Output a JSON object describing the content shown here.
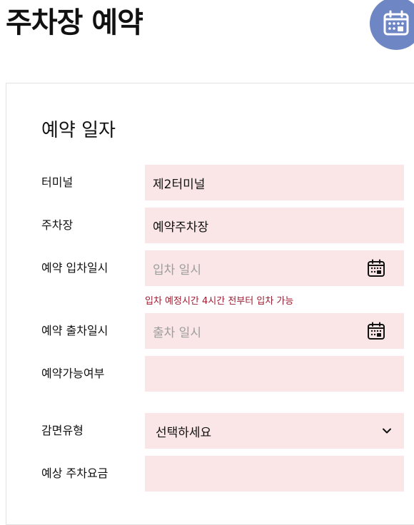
{
  "header": {
    "title": "주차장 예약",
    "fab_icon": "calendar-icon",
    "fab_color": "#6f86c5"
  },
  "form": {
    "section_title": "예약 일자",
    "field_bg": "#fae6e6",
    "terminal": {
      "label": "터미널",
      "value": "제2터미널"
    },
    "parking_lot": {
      "label": "주차장",
      "value": "예약주차장"
    },
    "entry": {
      "label": "예약 입차일시",
      "placeholder": "입차 일시",
      "icon": "calendar-icon"
    },
    "entry_hint": "입차 예정시간 4시간 전부터 입차 가능",
    "exit": {
      "label": "예약 출차일시",
      "placeholder": "출차 일시",
      "icon": "calendar-icon"
    },
    "availability": {
      "label": "예약가능여부",
      "value": ""
    },
    "discount": {
      "label": "감면유형",
      "selected": "선택하세요",
      "icon": "chevron-down-icon"
    },
    "fee": {
      "label": "예상 주차요금",
      "value": ""
    }
  }
}
